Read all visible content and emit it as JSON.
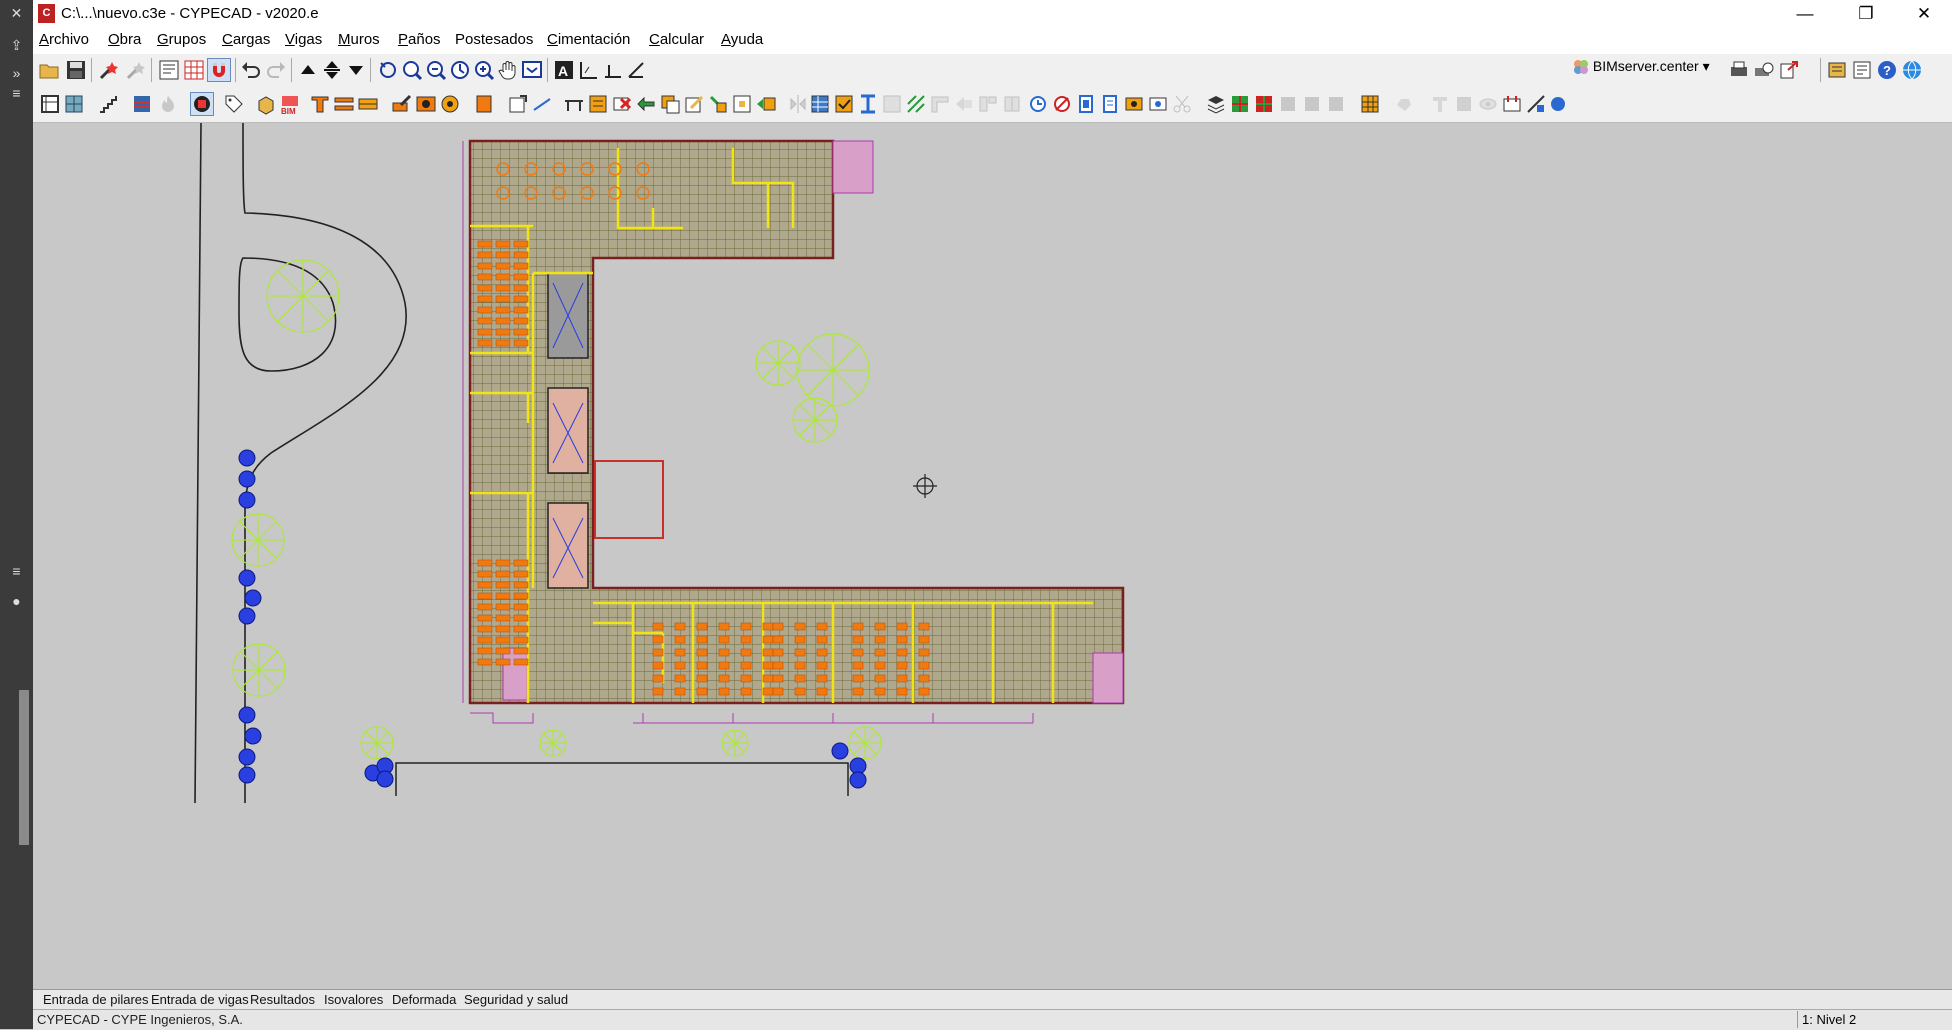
{
  "window": {
    "title": "C:\\...\\nuevo.c3e - CYPECAD - v2020.e",
    "app_icon_letter": "C"
  },
  "window_controls": {
    "minimize": "—",
    "restore": "❐",
    "close": "✕"
  },
  "menu": [
    {
      "mnemonic": "A",
      "rest": "rchivo"
    },
    {
      "mnemonic": "O",
      "rest": "bra"
    },
    {
      "mnemonic": "G",
      "rest": "rupos"
    },
    {
      "mnemonic": "C",
      "rest": "argas"
    },
    {
      "mnemonic": "V",
      "rest": "igas"
    },
    {
      "mnemonic": "M",
      "rest": "uros"
    },
    {
      "mnemonic": "P",
      "rest": "años"
    },
    {
      "mnemonic": "P",
      "rest": "ostesados",
      "pre": "",
      "underline_index": 2
    },
    {
      "mnemonic": "C",
      "rest": "imentación"
    },
    {
      "mnemonic": "C",
      "rest": "alcular"
    },
    {
      "mnemonic": "A",
      "rest": "yuda"
    }
  ],
  "menu_labels": [
    "Archivo",
    "Obra",
    "Grupos",
    "Cargas",
    "Vigas",
    "Muros",
    "Paños",
    "Postesados",
    "Cimentación",
    "Calcular",
    "Ayuda"
  ],
  "toolbar1": {
    "bimserver_label": "BIMserver.center",
    "bimserver_arrow": "▾"
  },
  "tabs": [
    "Entrada de pilares",
    "Entrada de vigas",
    "Resultados",
    "Isovalores",
    "Deformada",
    "Seguridad y salud"
  ],
  "status": {
    "company": "CYPECAD - CYPE Ingenieros, S.A.",
    "level": "1: Nivel 2"
  },
  "colors": {
    "canvas": "#c8c8c8",
    "slab_fill": "#b0a88c",
    "grid": "#6a6a3a",
    "wall": "#7a1f1f",
    "yellow_line": "#f2e313",
    "orange_block": "#f07a10",
    "tree": "#aee83a",
    "shrub": "#2a3fe0",
    "purple_line": "#b038b0"
  }
}
